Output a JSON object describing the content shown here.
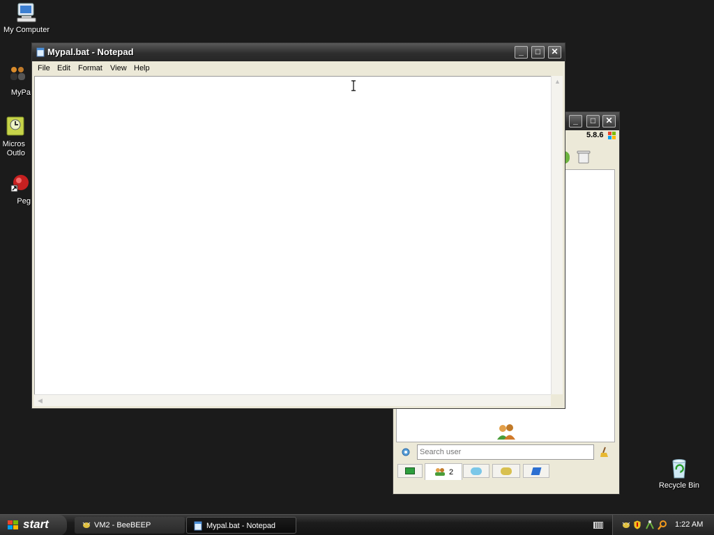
{
  "desktop": {
    "icons": [
      {
        "label": "My Computer"
      },
      {
        "label": "MyPa"
      },
      {
        "label": "Micros Outlo"
      },
      {
        "label": "Peg"
      },
      {
        "label": "Recycle Bin"
      }
    ]
  },
  "notepad": {
    "title": "Mypal.bat - Notepad",
    "menu": [
      "File",
      "Edit",
      "Format",
      "View",
      "Help"
    ],
    "content": ""
  },
  "beebeep": {
    "version": "5.8.6",
    "search_placeholder": "Search user",
    "users_tab_count": "2"
  },
  "taskbar": {
    "start_label": "start",
    "tasks": [
      {
        "label": "VM2 - BeeBEEP"
      },
      {
        "label": "Mypal.bat - Notepad"
      }
    ],
    "clock": "1:22 AM"
  }
}
